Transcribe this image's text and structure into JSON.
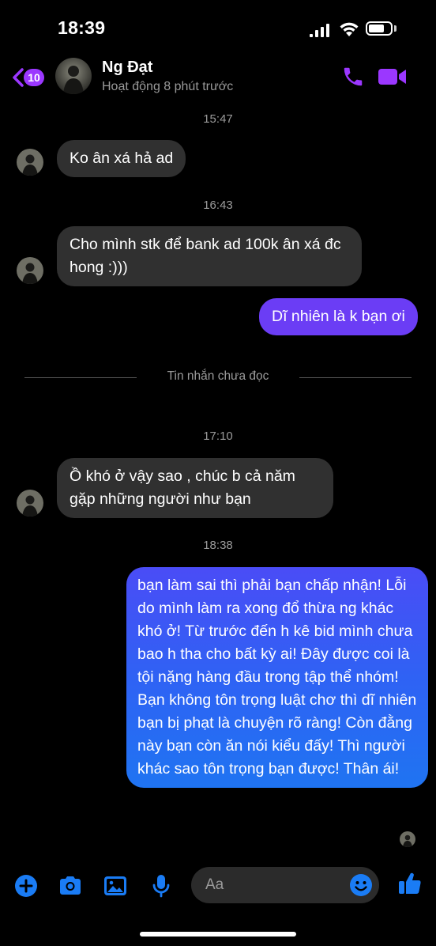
{
  "status_bar": {
    "time": "18:39"
  },
  "header": {
    "back_badge": "10",
    "contact_name": "Ng Đạt",
    "contact_status": "Hoạt động 8 phút trước"
  },
  "conversation": {
    "timestamps": [
      "15:47",
      "16:43",
      "17:10",
      "18:38"
    ],
    "messages": [
      {
        "sender": "contact",
        "text": "Ko ân xá hả ad"
      },
      {
        "sender": "contact",
        "text": "Cho mình stk để bank ad 100k ân xá đc hong :)))"
      },
      {
        "sender": "me",
        "text": "Dĩ nhiên là k bạn ơi"
      },
      {
        "sender": "contact",
        "text": "Ồ khó ở vậy sao , chúc b cả năm gặp những người như bạn"
      },
      {
        "sender": "me",
        "text": "bạn làm sai thì phải bạn chấp nhận! Lỗi do mình làm ra xong đổ thừa ng khác khó ở! Từ trước đến h kê bid mình chưa bao h tha cho bất kỳ ai! Đây được coi là tội nặng hàng đầu trong tập thể nhóm! Bạn không tôn trọng luật chơ thì dĩ nhiên bạn bị phạt là chuyện rõ ràng! Còn đằng này bạn còn ăn nói kiểu đấy! Thì người khác sao tôn trọng bạn được! Thân ái!"
      }
    ],
    "unread_divider": "Tin nhắn chưa đọc"
  },
  "composer": {
    "placeholder": "Aa"
  },
  "colors": {
    "accent": "#9b37ff",
    "incoming_bubble": "#303030",
    "outgoing_bubble_top": "#4a4cf6",
    "outgoing_bubble_bottom": "#1f74f2",
    "composer_icon": "#1a7cf5"
  },
  "icons": [
    "back-chevron-icon",
    "phone-icon",
    "video-camera-icon",
    "plus-icon",
    "camera-icon",
    "image-icon",
    "microphone-icon",
    "emoji-icon",
    "thumbs-up-icon"
  ]
}
